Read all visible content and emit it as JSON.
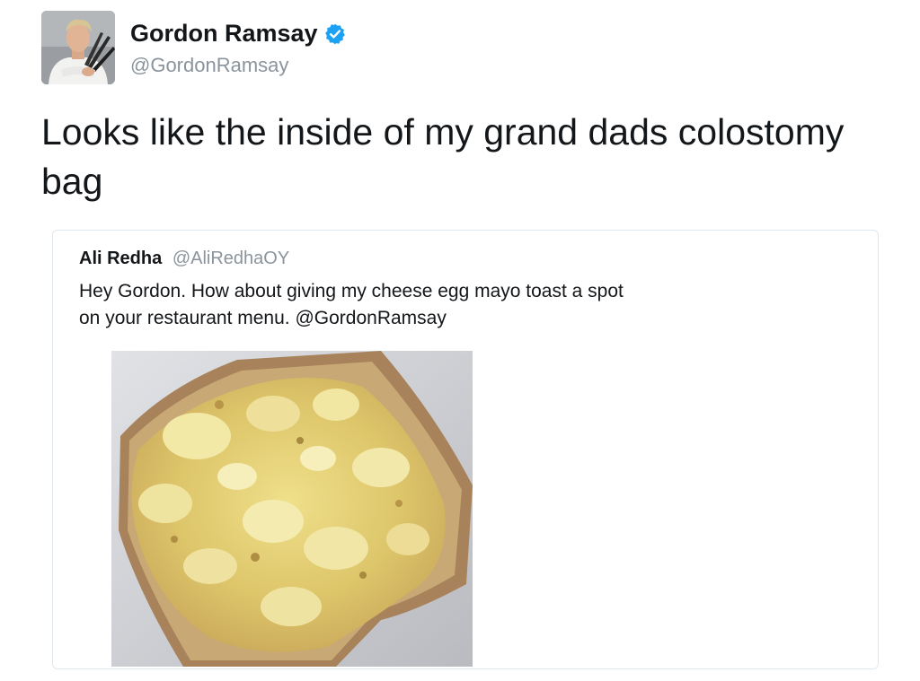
{
  "tweet": {
    "author_name": "Gordon Ramsay",
    "author_handle": "@GordonRamsay",
    "text": "Looks like the inside of my grand dads colostomy bag"
  },
  "quoted_tweet": {
    "author_name": "Ali Redha",
    "author_handle": "@AliRedhaOY",
    "text_line1": "Hey Gordon. How about giving my cheese egg mayo toast a spot",
    "text_line2": "on your restaurant menu. @GordonRamsay"
  },
  "icons": {
    "verified": "verified-badge-icon"
  },
  "colors": {
    "verified_blue": "#1da1f2",
    "handle_gray": "#8b949c",
    "text_dark": "#14171a",
    "card_border": "#e1e8ed"
  }
}
